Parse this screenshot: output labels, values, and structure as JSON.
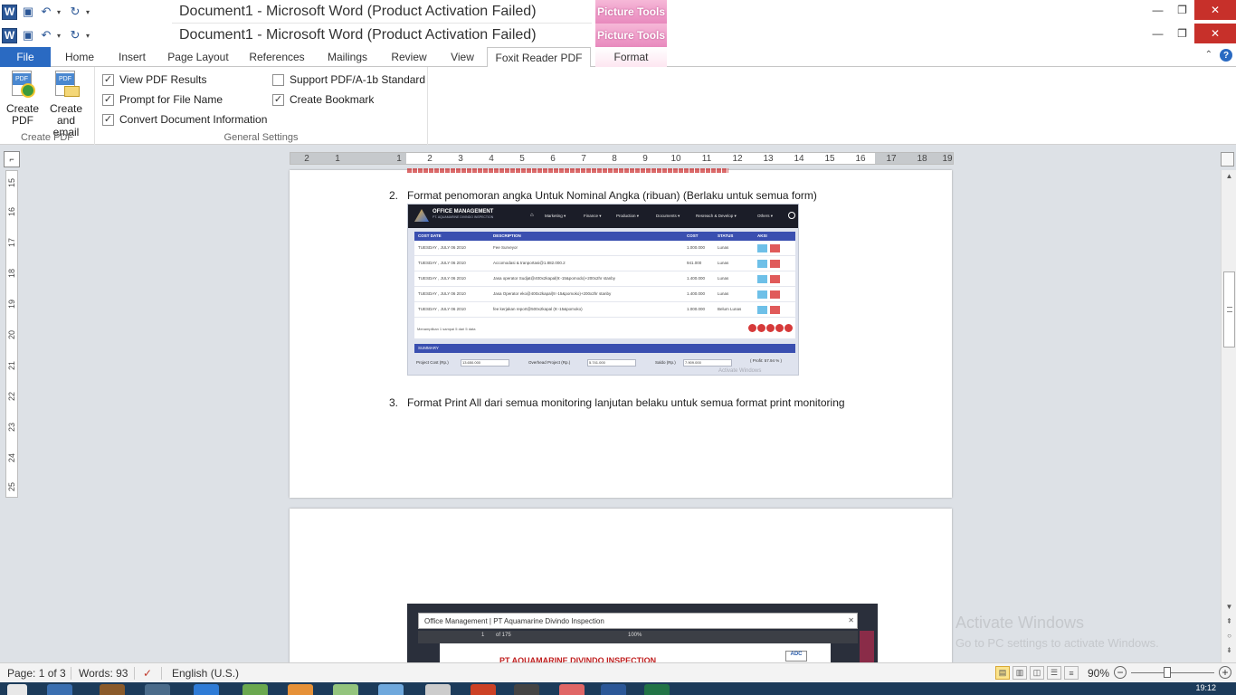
{
  "app": {
    "title": "Document1  -  Microsoft Word (Product Activation Failed)",
    "context_tab_group": "Picture Tools",
    "logo_letter": "W"
  },
  "ribbon_tabs": [
    "File",
    "Home",
    "Insert",
    "Page Layout",
    "References",
    "Mailings",
    "Review",
    "View",
    "Foxit Reader PDF",
    "Format"
  ],
  "active_tab": "Foxit Reader PDF",
  "ribbon": {
    "create_pdf_group": {
      "label": "Create PDF",
      "buttons": [
        {
          "line1": "Create",
          "line2": "PDF"
        },
        {
          "line1": "Create",
          "line2": "and email"
        }
      ]
    },
    "general_settings": {
      "label": "General Settings",
      "options": [
        {
          "label": "View PDF Results",
          "checked": true
        },
        {
          "label": "Prompt for File Name",
          "checked": true
        },
        {
          "label": "Convert Document Information",
          "checked": true
        },
        {
          "label": "Support PDF/A-1b Standard",
          "checked": false
        },
        {
          "label": "Create Bookmark",
          "checked": true
        }
      ]
    }
  },
  "ruler": {
    "ticks": [
      "2",
      "1",
      "1",
      "2",
      "3",
      "4",
      "5",
      "6",
      "7",
      "8",
      "9",
      "10",
      "11",
      "12",
      "13",
      "14",
      "15",
      "16",
      "17",
      "18",
      "19"
    ],
    "vertical_ticks": [
      "15",
      "16",
      "17",
      "18",
      "19",
      "20",
      "21",
      "22",
      "23",
      "24",
      "25"
    ]
  },
  "document": {
    "item2": {
      "number": "2.",
      "text": "Format penomoran angka  Untuk Nominal  Angka (ribuan) (Berlaku untuk semua form)"
    },
    "item3": {
      "number": "3.",
      "text": "Format Print All dari semua monitoring lanjutan belaku untuk semua format print monitoring"
    }
  },
  "embedded_screenshot_1": {
    "brand": "OFFICE MANAGEMENT",
    "brand_sub": "PT. AQUAMARINE DIVINDO INSPECTION",
    "menu": [
      "Marketing ▾",
      "Finance ▾",
      "Production ▾",
      "Documents ▾",
      "Resreach & Develop ▾",
      "Others ▾"
    ],
    "columns": [
      "COST DATE",
      "DESCRIPTION",
      "COST",
      "STATUS",
      "AKSI"
    ],
    "rows": [
      [
        "TUESDAY , JULY 06 2010",
        "Fee Surveyor",
        "1.000.000",
        "Lunas"
      ],
      [
        "TUESDAY , JULY 06 2010",
        "Accomodasi & tranportasi@1.882.000.2",
        "941.000",
        "Lunas"
      ],
      [
        "TUESDAY , JULY 06 2010",
        "Jasa operator Sudjat@400x2kapal(9:-15&pomodo)+200x2hr stanby",
        "1.400.000",
        "Lunas"
      ],
      [
        "TUESDAY , JULY 06 2010",
        "Jasa Operator eko@400x2kapal(9:-15&pomoko)+200x2hr stanby",
        "1.400.000",
        "Lunas"
      ],
      [
        "TUESDAY , JULY 06 2010",
        "fee kerjakan report@500x2kapal (9:-15&pomoko)",
        "1.000.000",
        "Belum Lunas"
      ]
    ],
    "footer": "Menampilkan 1 sampai 5 dari 5 data",
    "summary_label": "SUMMARY",
    "fields": [
      {
        "label": "Project Cost (Rp.)",
        "value": "13.650.000"
      },
      {
        "label": "Overhead Project (Rp.)",
        "value": "5.741.000"
      },
      {
        "label": "Saldo (Rp.)",
        "value": "7.909.000"
      }
    ],
    "profit": "( Profit: 57.94 % )",
    "watermark": "Activate Windows"
  },
  "embedded_screenshot_2": {
    "window_title": "Office Management | PT Aquamarine Divindo Inspection",
    "toolbar_page": "1",
    "toolbar_of": "of 175",
    "toolbar_zoom": "100%",
    "doc_heading": "PT AQUAMARINE DIVINDO INSPECTION",
    "logo": "ADC"
  },
  "watermark": {
    "line1": "Activate Windows",
    "line2": "Go to PC settings to activate Windows."
  },
  "statusbar": {
    "page": "Page: 1 of 3",
    "words": "Words: 93",
    "language": "English (U.S.)",
    "zoom": "90%"
  },
  "taskbar": {
    "clock": "19:12"
  },
  "colors": {
    "file_tab": "#2a6ac2",
    "context_tab": "#e889bd",
    "close_button": "#c7302a",
    "doc_background": "#dde1e6"
  }
}
